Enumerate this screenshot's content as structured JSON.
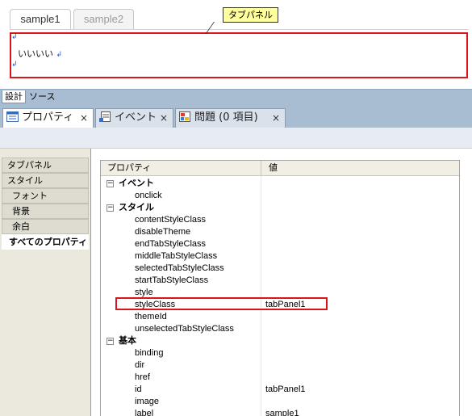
{
  "editor": {
    "tabs": [
      {
        "label": "sample1",
        "active": true
      },
      {
        "label": "sample2",
        "active": false
      }
    ],
    "panel_text": "いいいい",
    "pilcrow": "↲",
    "callout": "タブパネル"
  },
  "mode_tabs": {
    "design": "設計",
    "source": "ソース"
  },
  "view_tabs": [
    {
      "label": "プロパティ",
      "icon": "properties-icon",
      "active": true
    },
    {
      "label": "イベント",
      "icon": "events-icon",
      "active": false
    },
    {
      "label": "問題 (0 項目)",
      "icon": "problems-icon",
      "active": false
    }
  ],
  "close_glyph": "×",
  "categories": [
    {
      "label": "タブパネル",
      "sub": false,
      "selected": false
    },
    {
      "label": "スタイル",
      "sub": false,
      "selected": false
    },
    {
      "label": "フォント",
      "sub": true,
      "selected": false
    },
    {
      "label": "背景",
      "sub": true,
      "selected": false
    },
    {
      "label": "余白",
      "sub": true,
      "selected": false
    },
    {
      "label": "すべてのプロパティ",
      "sub": false,
      "selected": true
    }
  ],
  "property_grid": {
    "col_property": "プロパティ",
    "col_value": "値",
    "toggle_glyph": "−",
    "rows": [
      {
        "type": "group",
        "name": "イベント"
      },
      {
        "type": "prop",
        "name": "onclick",
        "value": ""
      },
      {
        "type": "group",
        "name": "スタイル"
      },
      {
        "type": "prop",
        "name": "contentStyleClass",
        "value": ""
      },
      {
        "type": "prop",
        "name": "disableTheme",
        "value": ""
      },
      {
        "type": "prop",
        "name": "endTabStyleClass",
        "value": ""
      },
      {
        "type": "prop",
        "name": "middleTabStyleClass",
        "value": ""
      },
      {
        "type": "prop",
        "name": "selectedTabStyleClass",
        "value": ""
      },
      {
        "type": "prop",
        "name": "startTabStyleClass",
        "value": ""
      },
      {
        "type": "prop",
        "name": "style",
        "value": ""
      },
      {
        "type": "prop",
        "name": "styleClass",
        "value": "tabPanel1"
      },
      {
        "type": "prop",
        "name": "themeId",
        "value": ""
      },
      {
        "type": "prop",
        "name": "unselectedTabStyleClass",
        "value": ""
      },
      {
        "type": "group",
        "name": "基本"
      },
      {
        "type": "prop",
        "name": "binding",
        "value": ""
      },
      {
        "type": "prop",
        "name": "dir",
        "value": ""
      },
      {
        "type": "prop",
        "name": "href",
        "value": ""
      },
      {
        "type": "prop",
        "name": "id",
        "value": "tabPanel1"
      },
      {
        "type": "prop",
        "name": "image",
        "value": ""
      },
      {
        "type": "prop",
        "name": "label",
        "value": "sample1"
      }
    ]
  },
  "colors": {
    "highlight": "#d8151b",
    "callout_bg": "#ffff9d",
    "view_bar": "#a9bdd2"
  }
}
